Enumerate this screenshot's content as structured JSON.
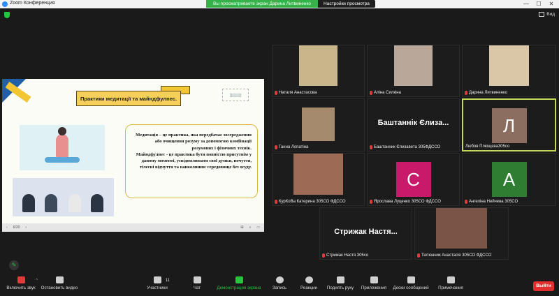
{
  "window": {
    "title": "Zoom Конференция",
    "minimize": "—",
    "maximize": "☐",
    "close": "✕"
  },
  "share_bar": {
    "status": "Вы просматриваете экран Дарина Литвиненко",
    "settings": "Настройки просмотра"
  },
  "view_button": {
    "label": "Вид"
  },
  "slide": {
    "title": "Практики медитації та майндфулнес.",
    "paragraph1": "Медитація – це практика, яка передбачає зосередження або очищення розуму за допомогою комбінації розумових і фізичних технік.",
    "paragraph2": "Майндфулнес - це практика бути повністю присутнім у даному моменті, усвідомлювати свої думки, почуття, тілесні відчуття та навколишнє середовище без осуду.",
    "nav_left": [
      "‹",
      "6/20",
      "›"
    ],
    "nav_right": [
      "⊞",
      "⌕",
      "▭"
    ]
  },
  "participants": [
    {
      "name": "Наталя Анастасова",
      "type": "video",
      "color": "#c9b58a"
    },
    {
      "name": "Аліна Силкіна",
      "type": "video",
      "color": "#b9a79a"
    },
    {
      "name": "Дарина Литвиненко",
      "type": "video",
      "color": "#d9c7a8"
    },
    {
      "name": "Ганна Лопатіна",
      "type": "video",
      "color": "#a58a6e"
    },
    {
      "name": "Баштанник Єлизавета 305ФДССО",
      "type": "text",
      "display": "Баштаннік Єлиза..."
    },
    {
      "name": "Любов Плющєва305со",
      "type": "avatar",
      "letter": "Л",
      "color": "#8c6e61"
    },
    {
      "name": "КурКоВа Катерина 305СО ФДССО",
      "type": "video",
      "color": "#9d6a55"
    },
    {
      "name": "Ярослава Луценко 305СО ФДССО",
      "type": "avatar",
      "letter": "С",
      "color": "#c8196b"
    },
    {
      "name": "Ангеліна Нейчева 305СО",
      "type": "avatar",
      "letter": "А",
      "color": "#2e7d32"
    },
    {
      "name": "Стрижак Настя 305со",
      "type": "text",
      "display": "Стрижак Настя..."
    },
    {
      "name": "Тютюнник Анастасія 305СО ФДССО",
      "type": "video",
      "color": "#7a5547"
    }
  ],
  "toolbar": {
    "mute": "Включить звук",
    "video": "Остановить видео",
    "participants": "Участники",
    "participants_count": "11",
    "chat": "Чат",
    "share": "Демонстрация экрана",
    "record": "Запись",
    "reactions": "Реакции",
    "raise_hand": "Поднять руку",
    "apps": "Приложения",
    "whiteboard": "Доски сообщений",
    "notes": "Примечания",
    "leave": "Выйти"
  }
}
